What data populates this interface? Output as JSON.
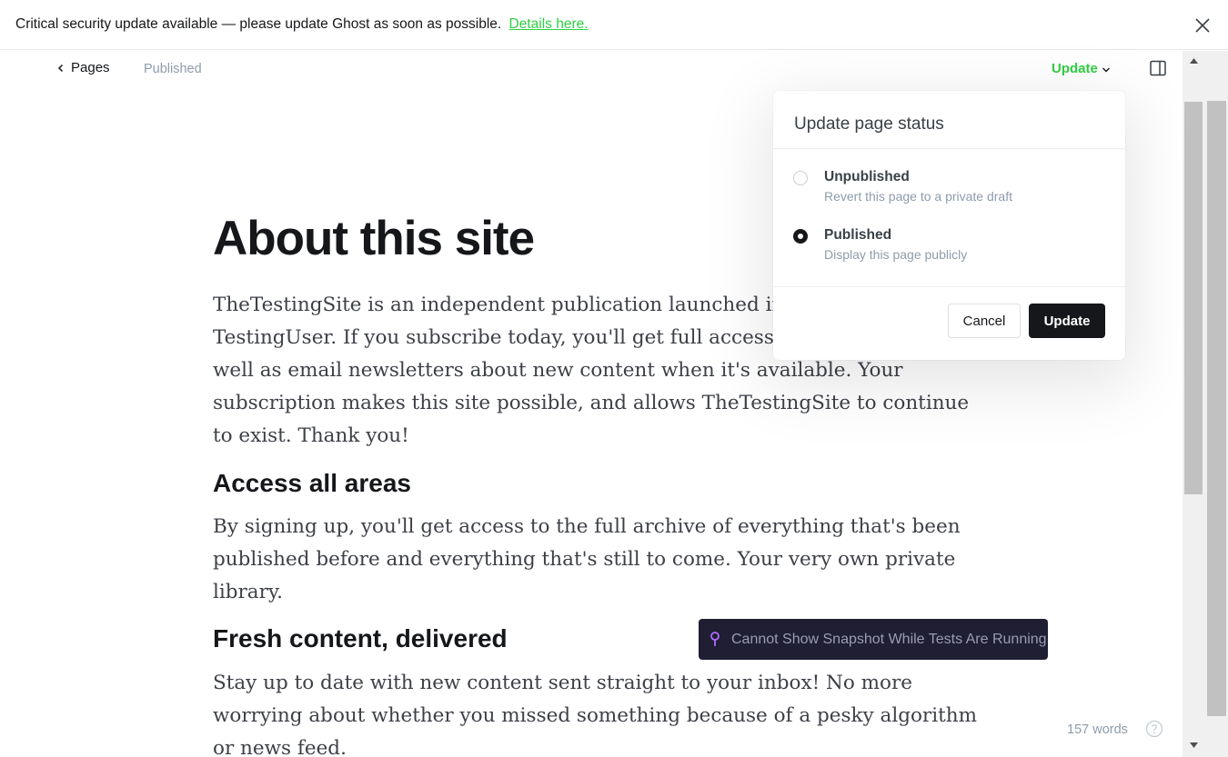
{
  "banner": {
    "message": "Critical security update available — please update Ghost as soon as possible.",
    "link_label": "Details here."
  },
  "header": {
    "back_label": "Pages",
    "status": "Published",
    "update_label": "Update"
  },
  "article": {
    "title": "About this site",
    "paragraph_1": "TheTestingSite is an independent publication launched in March 2023 by TestingUser. If you subscribe today, you'll get full access to the website as well as email newsletters about new content when it's available. Your subscription makes this site possible, and allows TheTestingSite to continue to exist. Thank you!",
    "heading_1": "Access all areas",
    "paragraph_2": "By signing up, you'll get access to the full archive of everything that's been published before and everything that's still to come. Your very own private library.",
    "heading_2": "Fresh content, delivered",
    "paragraph_3": "Stay up to date with new content sent straight to your inbox! No more worrying about whether you missed something because of a pesky algorithm or news feed."
  },
  "footer": {
    "word_count": "157 words"
  },
  "popover": {
    "title": "Update page status",
    "options": [
      {
        "label": "Unpublished",
        "description": "Revert this page to a private draft",
        "selected": false
      },
      {
        "label": "Published",
        "description": "Display this page publicly",
        "selected": true
      }
    ],
    "cancel_label": "Cancel",
    "update_label": "Update"
  },
  "toast": {
    "message": "Cannot Show Snapshot While Tests Are Running"
  },
  "colors": {
    "accent_green": "#30cf43",
    "dark": "#15171a",
    "toast_bg": "#1f1e33",
    "toast_icon": "#b26bff"
  },
  "icons": [
    "close-icon",
    "chevron-left-icon",
    "chevron-down-icon",
    "sidebar-toggle-icon",
    "help-icon",
    "pin-icon",
    "scroll-up-arrow-icon",
    "scroll-down-arrow-icon"
  ]
}
